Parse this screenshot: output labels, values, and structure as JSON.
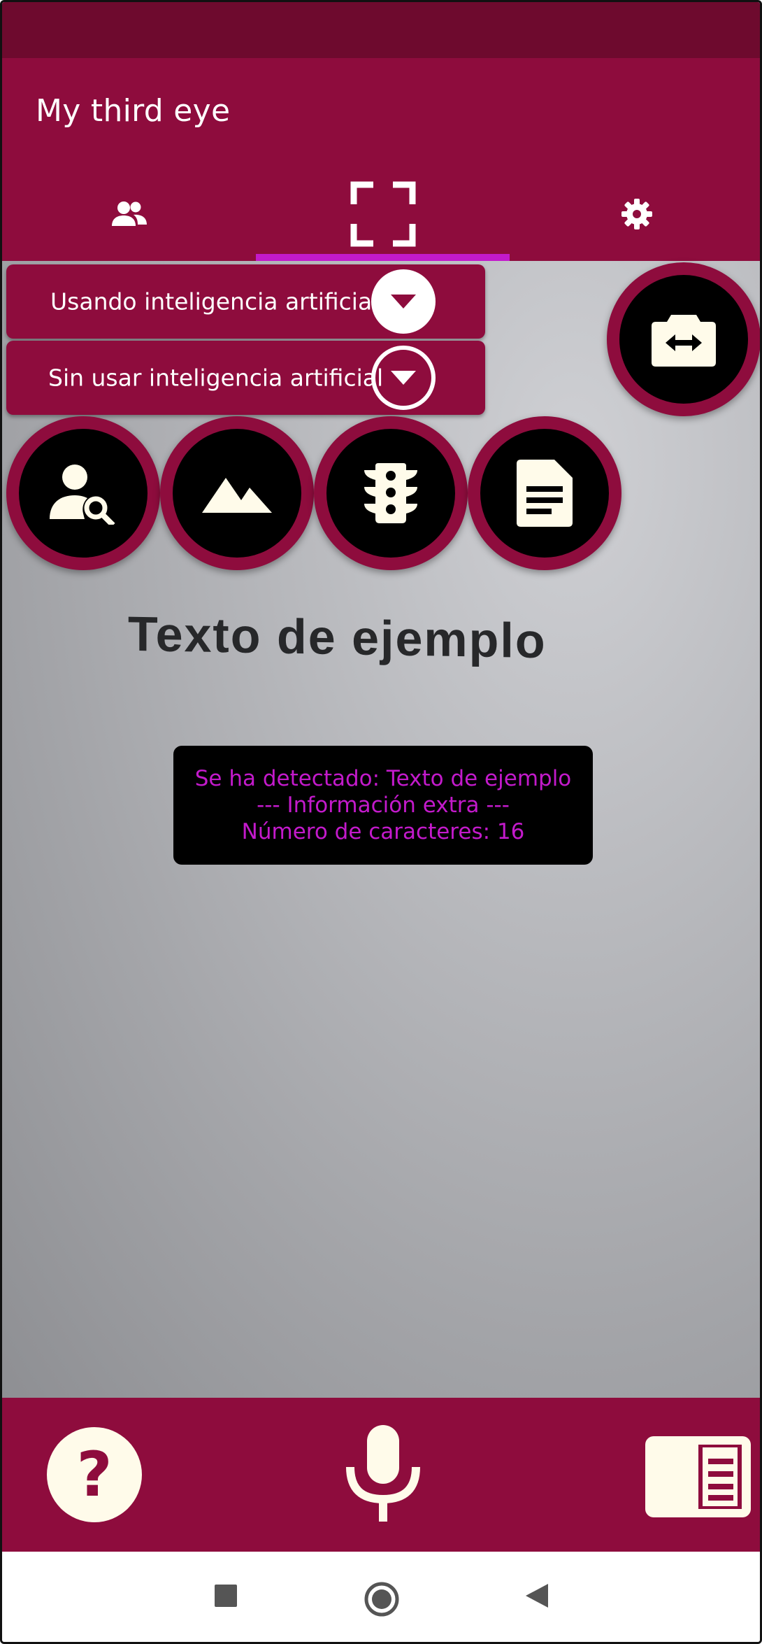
{
  "app": {
    "title": "My third eye"
  },
  "tabs": [
    {
      "icon": "people-icon"
    },
    {
      "icon": "scan-frame-icon",
      "selected": true
    },
    {
      "icon": "gear-icon"
    }
  ],
  "modes": {
    "ai_label": "Usando inteligencia artificial",
    "no_ai_label": "Sin usar inteligencia artificial"
  },
  "actions": [
    {
      "icon": "person-search-icon"
    },
    {
      "icon": "landscape-icon"
    },
    {
      "icon": "traffic-light-icon"
    },
    {
      "icon": "document-icon"
    }
  ],
  "camera_switch": {
    "icon": "switch-camera-icon"
  },
  "camera_view": {
    "sample_text": "Texto de ejemplo"
  },
  "result": {
    "line1": "Se ha detectado: Texto de ejemplo",
    "line2": "--- Información extra ---",
    "line3": "Número de caracteres: 16"
  },
  "bottom": {
    "help_icon": "help-icon",
    "mic_icon": "microphone-icon",
    "panel_icon": "side-panel-icon"
  },
  "colors": {
    "primary": "#8e0c3d",
    "status_bar": "#6e0a2e",
    "accent": "#c31acb",
    "icon_fill": "#fffbea"
  }
}
